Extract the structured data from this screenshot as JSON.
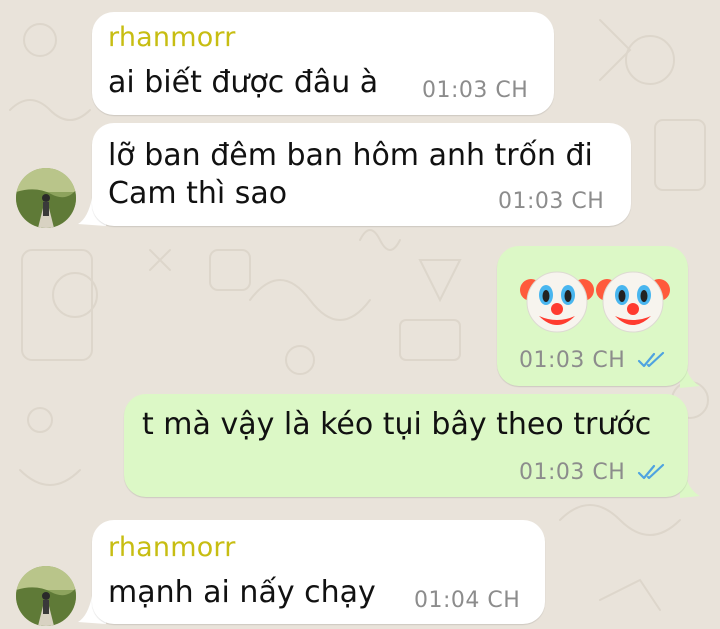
{
  "colors": {
    "background": "#e9e3da",
    "incoming_bubble": "#ffffff",
    "outgoing_bubble": "#dcf8c6",
    "sender_name": "#c7bd12",
    "timestamp": "#8c8c8c",
    "read_ticks": "#4fa3e0"
  },
  "messages": [
    {
      "sender": "rhanmorr",
      "text": "ai biết được đâu à",
      "time": "01:03 CH"
    },
    {
      "lines": [
        "lỡ ban đêm ban hôm anh trốn đi",
        "Cam thì sao"
      ],
      "time": "01:03 CH"
    },
    {
      "emoji": [
        "clown-face",
        "clown-face"
      ],
      "time": "01:03 CH",
      "status": "read"
    },
    {
      "text": "t mà vậy là kéo tụi bây theo trước",
      "time": "01:03 CH",
      "status": "read"
    },
    {
      "sender": "rhanmorr",
      "text": "mạnh ai nấy chạy",
      "time": "01:04 CH"
    }
  ]
}
